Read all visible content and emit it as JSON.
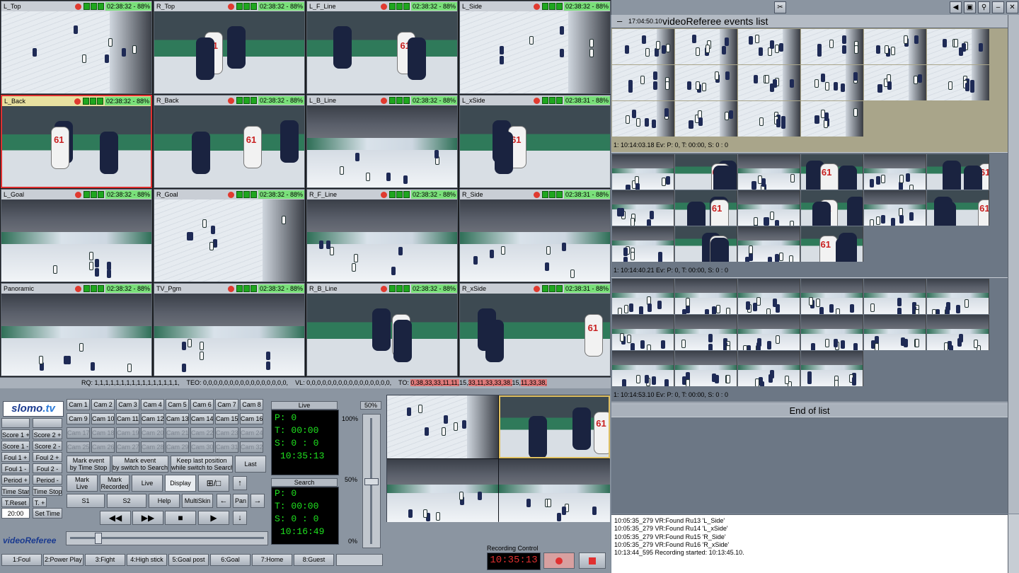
{
  "cameras": [
    {
      "name": "L_Top",
      "tc": "02:38:32 - 88%"
    },
    {
      "name": "R_Top",
      "tc": "02:38:32 - 88%"
    },
    {
      "name": "L_F_Line",
      "tc": "02:38:32 - 88%"
    },
    {
      "name": "L_Side",
      "tc": "02:38:32 - 88%"
    },
    {
      "name": "L_Back",
      "tc": "02:38:32 - 88%"
    },
    {
      "name": "R_Back",
      "tc": "02:38:32 - 88%"
    },
    {
      "name": "L_B_Line",
      "tc": "02:38:32 - 88%"
    },
    {
      "name": "L_xSide",
      "tc": "02:38:31 - 88%"
    },
    {
      "name": "L_Goal",
      "tc": "02:38:32 - 88%"
    },
    {
      "name": "R_Goal",
      "tc": "02:38:32 - 88%"
    },
    {
      "name": "R_F_Line",
      "tc": "02:38:32 - 88%"
    },
    {
      "name": "R_Side",
      "tc": "02:38:31 - 88%"
    },
    {
      "name": "Panoramic",
      "tc": "02:38:32 - 88%"
    },
    {
      "name": "TV_Pgm",
      "tc": "02:38:32 - 88%"
    },
    {
      "name": "R_B_Line",
      "tc": "02:38:32 - 88%"
    },
    {
      "name": "R_xSide",
      "tc": "02:38:31 - 88%"
    }
  ],
  "status": {
    "rq": "RQ: 1,1,1,1,1,1,1,1,1,1,1,1,1,1,1,1,",
    "teo": "TEO: 0,0,0,0,0,0,0,0,0,0,0,0,0,0,0,0,",
    "vl": "VL: 0,0,0,0,0,0,0,0,0,0,0,0,0,0,0,0,",
    "to_label": "TO:",
    "to_1": "0,38,33,33,11,11,",
    "to_2": "15,",
    "to_3": "33,11,33,33,38,",
    "to_4": "15,",
    "to_5": "11,33,38,"
  },
  "logo": {
    "a": "slomo",
    "b": ".tv"
  },
  "score_buttons": [
    "Score 1 +",
    "Score 2 +",
    "Score 1 -",
    "Score 2 -",
    "Foul 1 +",
    "Foul 2 +",
    "Foul 1 -",
    "Foul 2 -",
    "Period +",
    "Period -",
    "Time Start",
    "Time Stop",
    "T.Reset",
    "T. +",
    "T. -"
  ],
  "time_value": "20:00",
  "set_time": "Set Time",
  "cam_buttons": [
    "Cam 1",
    "Cam 2",
    "Cam 3",
    "Cam 4",
    "Cam 5",
    "Cam 6",
    "Cam 7",
    "Cam 8",
    "Cam 9",
    "Cam 10",
    "Cam 11",
    "Cam 12",
    "Cam 13",
    "Cam 14",
    "Cam 15",
    "Cam 16",
    "Cam 17",
    "Cam 18",
    "Cam 19",
    "Cam 20",
    "Cam 21",
    "Cam 22",
    "Cam 23",
    "Cam 24",
    "Cam 25",
    "Cam 26",
    "Cam 27",
    "Cam 28",
    "Cam 29",
    "Cam 30",
    "Cam 31",
    "Cam 32"
  ],
  "actions": {
    "mark_time_stop_1": "Mark event",
    "mark_time_stop_2": "by Time Stop",
    "mark_switch_1": "Mark event",
    "mark_switch_2": "by switch to Search",
    "keep_last_1": "Keep last position",
    "keep_last_2": "while switch to Search",
    "last": "Last",
    "mark_live_1": "Mark",
    "mark_live_2": "Live",
    "mark_rec_1": "Mark",
    "mark_rec_2": "Recorded",
    "live": "Live",
    "display": "Display",
    "layout": "⊞/□",
    "s1": "S1",
    "s2": "S2",
    "help": "Help",
    "multiskin": "MultiSkin",
    "pan": "Pan"
  },
  "live_panel": {
    "title": "Live",
    "p": "P: 0",
    "t": "T:  00:00",
    "s": "S:  0 : 0",
    "clock": "10:35:13"
  },
  "search_panel": {
    "title": "Search",
    "p": "P: 0",
    "t": "T:  00:00",
    "s": "S:  0 : 0",
    "clock": "10:16:49"
  },
  "slider": {
    "top": "50%",
    "p100": "100%",
    "p50": "50%",
    "p0": "0%",
    "level": 0.5
  },
  "brand": "videoReferee",
  "hotkeys": [
    "1:Foul",
    "2:Power Play",
    "3:Fight",
    "4:High stick",
    "5:Goal post",
    "6:Goal",
    "7:Home",
    "8:Guest"
  ],
  "recording": {
    "label": "Recording Control",
    "time": "10:35:13"
  },
  "events_header": {
    "minus": "–",
    "time": "17:04:50.10",
    "title": "videoReferee events list"
  },
  "events": [
    {
      "caption": "1: 10:14:03.18  Ev:  P: 0,   T: 00:00,   S: 0 : 0"
    },
    {
      "caption": "1: 10:14:40.21  Ev:  P: 0,   T: 00:00,   S: 0 : 0"
    },
    {
      "caption": "1: 10:14:53.10  Ev:  P: 0,   T: 00:00,   S: 0 : 0"
    }
  ],
  "end_of_list": "End of list",
  "log": [
    "10:05:35_279   VR:Found Ru13 'L_Side'",
    "10:05:35_279   VR:Found Ru14 'L_xSide'",
    "10:05:35_279   VR:Found Ru15 'R_Side'",
    "10:05:35_279   VR:Found Ru16 'R_xSide'",
    "10:13:44_595   Recording started: 10:13:45.10."
  ],
  "window_buttons": [
    "tools-icon",
    "speaker-icon",
    "layout-icon",
    "pin-icon",
    "minimize-icon",
    "close-icon"
  ],
  "colors": {
    "live_text": "#1fe21f",
    "record_red": "#e03030",
    "tc_green": "#7ae07a",
    "selected_event": "#a9a58a"
  }
}
